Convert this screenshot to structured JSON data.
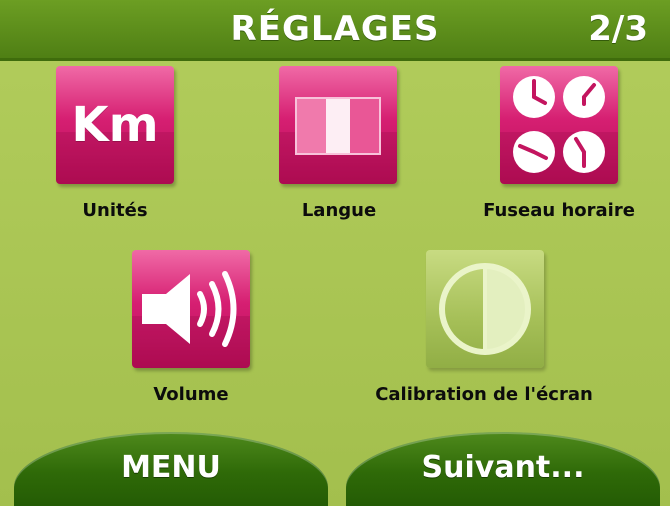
{
  "header": {
    "title": "RÉGLAGES",
    "page": "2/3"
  },
  "tiles": [
    {
      "label": "Unités",
      "icon": "km-units-icon",
      "glyph": "Km",
      "color": "#d61f72"
    },
    {
      "label": "Langue",
      "icon": "language-flag-icon",
      "color": "#d61f72"
    },
    {
      "label": "Fuseau horaire",
      "icon": "timezone-clocks-icon",
      "color": "#d61f72"
    },
    {
      "label": "Volume",
      "icon": "speaker-volume-icon",
      "color": "#d61f72"
    },
    {
      "label": "Calibration de l'écran",
      "icon": "screen-calibration-icon",
      "color": "#a5bf57"
    }
  ],
  "footer": {
    "menu_label": "MENU",
    "next_label": "Suivant..."
  },
  "colors": {
    "background": "#a9c452",
    "header": "#5a8a1a",
    "button": "#2f6a08",
    "tile": "#d61f72"
  }
}
